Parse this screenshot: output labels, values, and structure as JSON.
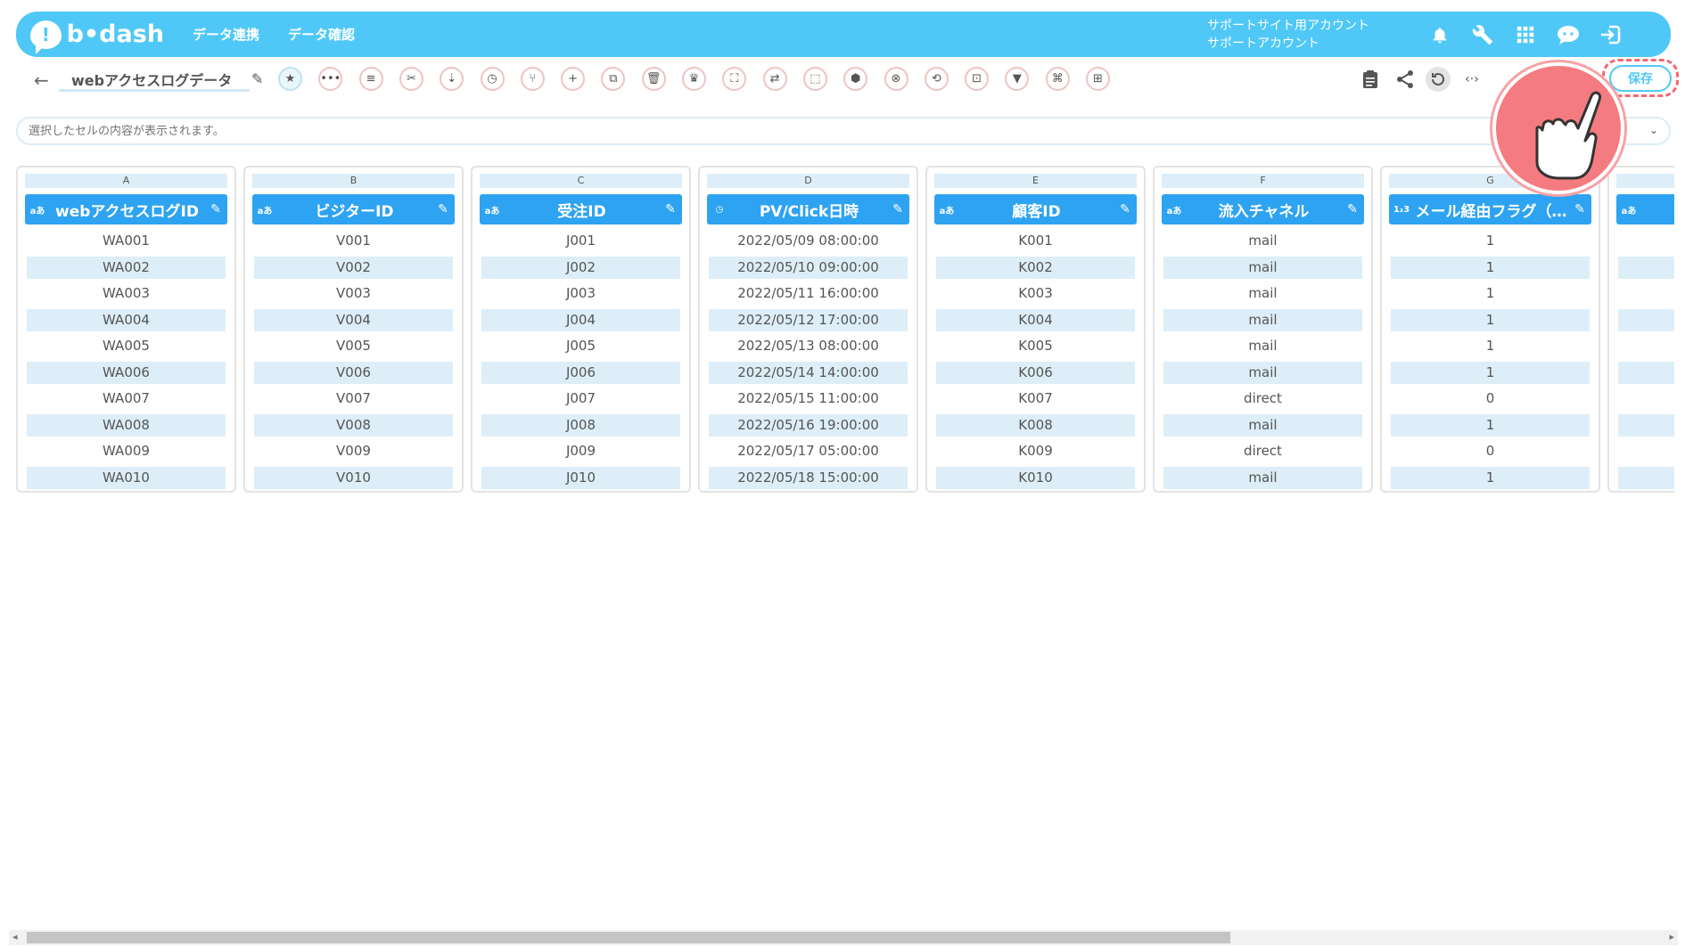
{
  "app": {
    "logo_text": "b•dash",
    "logo_mark": "!"
  },
  "nav": {
    "link1": "データ連携",
    "link2": "データ確認"
  },
  "account": {
    "line1": "サポートサイト用アカウント",
    "line2": "サポートアカウント"
  },
  "top_icons": [
    "bell-icon",
    "wrench-icon",
    "apps-icon",
    "chat-icon",
    "logout-icon"
  ],
  "sheet": {
    "back": "←",
    "title": "webアクセスログデータ",
    "edit": "✎"
  },
  "toolbar": {
    "tools": [
      "★",
      "•••",
      "≡",
      "✂",
      "⇣",
      "◷",
      "⑂",
      "+",
      "⧉",
      "🗑",
      "♛",
      "⛶",
      "⇄",
      "⬚",
      "⬢",
      "⊗",
      "⟲",
      "⊡",
      "▼",
      "⌘",
      "⊞"
    ],
    "tool_names": [
      "favorite",
      "more",
      "text",
      "cut",
      "split",
      "timer",
      "branch",
      "add",
      "copy",
      "delete",
      "crown",
      "expand",
      "swap",
      "lock",
      "package",
      "close",
      "convert",
      "frame",
      "filter",
      "hash",
      "grid"
    ]
  },
  "right_toolbar": {
    "clipboard": "📋",
    "share": "⤤",
    "history": "⟳",
    "code": "‹·›"
  },
  "save_label": "保存",
  "cellbar": {
    "placeholder": "選択したセルの内容が表示されます。",
    "chevron": "⌄"
  },
  "columns": [
    {
      "letter": "A",
      "type": "aあ",
      "name": "webアクセスログID",
      "values": [
        "WA001",
        "WA002",
        "WA003",
        "WA004",
        "WA005",
        "WA006",
        "WA007",
        "WA008",
        "WA009",
        "WA010"
      ]
    },
    {
      "letter": "B",
      "type": "aあ",
      "name": "ビジターID",
      "values": [
        "V001",
        "V002",
        "V003",
        "V004",
        "V005",
        "V006",
        "V007",
        "V008",
        "V009",
        "V010"
      ]
    },
    {
      "letter": "C",
      "type": "aあ",
      "name": "受注ID",
      "values": [
        "J001",
        "J002",
        "J003",
        "J004",
        "J005",
        "J006",
        "J007",
        "J008",
        "J009",
        "J010"
      ]
    },
    {
      "letter": "D",
      "type": "◷",
      "name": "PV/Click日時",
      "values": [
        "2022/05/09 08:00:00",
        "2022/05/10 09:00:00",
        "2022/05/11 16:00:00",
        "2022/05/12 17:00:00",
        "2022/05/13 08:00:00",
        "2022/05/14 14:00:00",
        "2022/05/15 11:00:00",
        "2022/05/16 19:00:00",
        "2022/05/17 05:00:00",
        "2022/05/18 15:00:00"
      ]
    },
    {
      "letter": "E",
      "type": "aあ",
      "name": "顧客ID",
      "values": [
        "K001",
        "K002",
        "K003",
        "K004",
        "K005",
        "K006",
        "K007",
        "K008",
        "K009",
        "K010"
      ]
    },
    {
      "letter": "F",
      "type": "aあ",
      "name": "流入チャネル",
      "values": [
        "mail",
        "mail",
        "mail",
        "mail",
        "mail",
        "mail",
        "direct",
        "mail",
        "direct",
        "mail"
      ]
    },
    {
      "letter": "G",
      "type": "1₂3",
      "name": "メール経由フラグ（…",
      "values": [
        "1",
        "1",
        "1",
        "1",
        "1",
        "1",
        "0",
        "1",
        "0",
        "1"
      ]
    },
    {
      "letter": "",
      "type": "aあ",
      "name": "",
      "values": [
        "",
        "",
        "",
        "",
        "",
        "",
        "",
        "",
        "",
        ""
      ]
    }
  ],
  "scrollbar": {
    "left": "◂",
    "right": "▸"
  }
}
